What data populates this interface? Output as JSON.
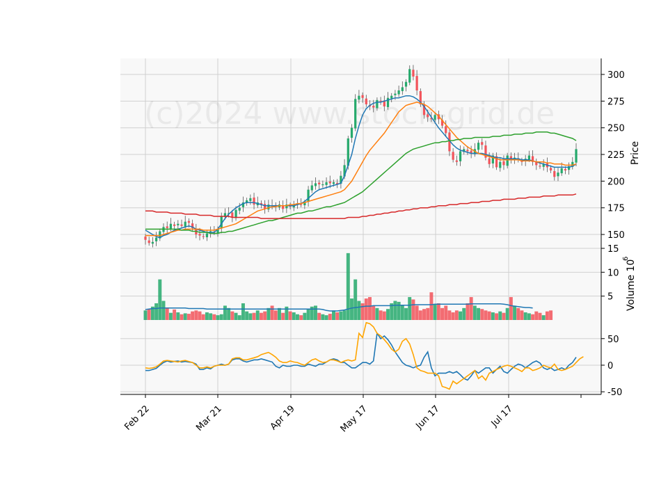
{
  "chart_data": {
    "type": "candlestick",
    "watermark": "(c)2024 www.stock-grid.de",
    "x_ticks": [
      "Feb 22",
      "Mar 21",
      "Apr 19",
      "May 17",
      "Jun 17",
      "Jul 17"
    ],
    "colors": {
      "up": "#26a96c",
      "down": "#f2545b",
      "grid": "#d0d0d0",
      "panel": "#f8f8f8"
    },
    "price_panel": {
      "ylabel": "Price",
      "yticks": [
        150,
        175,
        200,
        225,
        250,
        275,
        300
      ],
      "ylim": [
        137,
        315
      ],
      "close": [
        145,
        142,
        143,
        147,
        153,
        157,
        156,
        160,
        158,
        160,
        158,
        162,
        161,
        156,
        150,
        149,
        148,
        151,
        153,
        152,
        155,
        167,
        170,
        170,
        166,
        173,
        175,
        180,
        182,
        184,
        178,
        180,
        178,
        174,
        178,
        177,
        176,
        178,
        174,
        178,
        176,
        178,
        179,
        178,
        180,
        192,
        196,
        198,
        197,
        197,
        199,
        198,
        199,
        197,
        205,
        215,
        240,
        250,
        277,
        280,
        278,
        272,
        270,
        269,
        276,
        275,
        270,
        278,
        280,
        282,
        285,
        288,
        293,
        305,
        298,
        285,
        272,
        262,
        260,
        258,
        262,
        258,
        252,
        245,
        228,
        220,
        218,
        228,
        230,
        228,
        226,
        230,
        236,
        234,
        222,
        216,
        224,
        213,
        218,
        215,
        224,
        220,
        222,
        220,
        218,
        221,
        224,
        218,
        215,
        214,
        216,
        213,
        210,
        204,
        208,
        212,
        210,
        214,
        218,
        230
      ]
    },
    "moving_averages": {
      "fast": {
        "color": "#1f77b4",
        "values": [
          154,
          152,
          150,
          148,
          147,
          149,
          150,
          152,
          154,
          155,
          156,
          157,
          158,
          157,
          155,
          154,
          153,
          152,
          152,
          152,
          155,
          160,
          165,
          169,
          172,
          175,
          177,
          179,
          180,
          180,
          180,
          179,
          178,
          177,
          177,
          177,
          177,
          177,
          177,
          177,
          177,
          177,
          178,
          179,
          181,
          184,
          187,
          190,
          192,
          193,
          194,
          195,
          196,
          197,
          198,
          205,
          215,
          225,
          240,
          252,
          262,
          268,
          271,
          273,
          274,
          274,
          275,
          276,
          277,
          278,
          278,
          279,
          280,
          280,
          279,
          277,
          274,
          270,
          265,
          260,
          255,
          250,
          246,
          242,
          238,
          234,
          231,
          229,
          228,
          227,
          226,
          226,
          226,
          226,
          225,
          224,
          223,
          222,
          222,
          221,
          221,
          221,
          221,
          221,
          220,
          220,
          220,
          219,
          218,
          217,
          216,
          215,
          214,
          213,
          213,
          213,
          213,
          213,
          214,
          216
        ]
      },
      "medium": {
        "color": "#ff7f0e",
        "values": [
          149,
          149,
          149,
          149,
          149,
          150,
          151,
          152,
          153,
          154,
          154,
          155,
          155,
          155,
          155,
          155,
          154,
          154,
          154,
          154,
          155,
          156,
          157,
          158,
          159,
          160,
          162,
          164,
          166,
          168,
          170,
          172,
          173,
          174,
          175,
          176,
          176,
          177,
          177,
          177,
          178,
          178,
          179,
          179,
          180,
          181,
          182,
          183,
          184,
          185,
          186,
          187,
          188,
          189,
          190,
          192,
          196,
          200,
          206,
          212,
          218,
          224,
          229,
          233,
          237,
          241,
          245,
          250,
          255,
          260,
          265,
          268,
          271,
          272,
          273,
          274,
          273,
          272,
          270,
          267,
          264,
          261,
          257,
          253,
          249,
          245,
          241,
          238,
          235,
          232,
          230,
          228,
          226,
          225,
          224,
          223,
          222,
          221,
          220,
          220,
          220,
          220,
          220,
          220,
          219,
          219,
          219,
          219,
          218,
          218,
          218,
          217,
          217,
          216,
          216,
          216,
          215,
          215,
          215,
          216
        ]
      },
      "slow": {
        "color": "#2ca02c",
        "values": [
          155,
          155,
          155,
          155,
          155,
          155,
          155,
          155,
          155,
          155,
          154,
          154,
          154,
          153,
          153,
          152,
          152,
          152,
          151,
          151,
          151,
          152,
          152,
          153,
          153,
          154,
          155,
          156,
          157,
          158,
          159,
          160,
          161,
          162,
          163,
          163,
          164,
          165,
          166,
          167,
          168,
          169,
          170,
          170,
          171,
          172,
          172,
          173,
          174,
          175,
          176,
          176,
          177,
          178,
          179,
          180,
          182,
          184,
          186,
          188,
          190,
          193,
          196,
          199,
          202,
          205,
          208,
          211,
          214,
          217,
          220,
          223,
          226,
          228,
          230,
          231,
          232,
          233,
          234,
          235,
          236,
          236,
          237,
          237,
          238,
          238,
          239,
          239,
          240,
          240,
          240,
          241,
          241,
          241,
          241,
          241,
          242,
          242,
          242,
          243,
          243,
          243,
          244,
          244,
          244,
          245,
          245,
          245,
          246,
          246,
          246,
          246,
          245,
          245,
          244,
          243,
          242,
          241,
          240,
          238
        ]
      },
      "long": {
        "color": "#d62728",
        "values": [
          172,
          172,
          172,
          171,
          171,
          171,
          171,
          170,
          170,
          170,
          170,
          169,
          169,
          169,
          169,
          168,
          168,
          168,
          168,
          167,
          167,
          167,
          167,
          167,
          166,
          166,
          166,
          166,
          166,
          166,
          166,
          166,
          165,
          165,
          165,
          165,
          165,
          165,
          165,
          165,
          165,
          165,
          165,
          165,
          165,
          165,
          165,
          165,
          165,
          165,
          165,
          165,
          165,
          165,
          165,
          165,
          166,
          166,
          166,
          166,
          167,
          167,
          168,
          168,
          169,
          169,
          170,
          170,
          171,
          171,
          172,
          172,
          173,
          173,
          174,
          174,
          175,
          175,
          175,
          176,
          176,
          177,
          177,
          177,
          178,
          178,
          178,
          179,
          179,
          179,
          180,
          180,
          180,
          181,
          181,
          181,
          182,
          182,
          182,
          183,
          183,
          183,
          183,
          184,
          184,
          184,
          185,
          185,
          185,
          185,
          186,
          186,
          186,
          186,
          187,
          187,
          187,
          187,
          187,
          188
        ]
      }
    },
    "volume_panel": {
      "ylabel": "Volume  10",
      "ylabel_exponent": "6",
      "yticks": [
        5,
        10,
        15
      ],
      "ylim": [
        0,
        15
      ],
      "values": [
        2.0,
        2.3,
        2.8,
        3.5,
        8.5,
        4.0,
        2.5,
        1.5,
        2.2,
        1.6,
        1.2,
        1.4,
        1.3,
        1.8,
        2.0,
        1.8,
        1.2,
        1.6,
        1.4,
        1.2,
        1.0,
        1.2,
        3.0,
        2.5,
        1.8,
        1.5,
        1.0,
        3.5,
        1.8,
        1.4,
        1.5,
        2.0,
        1.5,
        1.8,
        2.5,
        3.0,
        2.0,
        2.5,
        1.5,
        2.8,
        1.8,
        1.6,
        1.2,
        1.0,
        1.5,
        2.3,
        2.8,
        3.0,
        1.5,
        1.2,
        1.0,
        1.3,
        2.0,
        1.6,
        1.8,
        2.0,
        14.0,
        4.5,
        8.5,
        4.0,
        3.5,
        4.5,
        4.8,
        3.0,
        2.5,
        2.0,
        1.8,
        2.3,
        3.5,
        4.0,
        3.8,
        3.0,
        2.5,
        4.8,
        4.3,
        3.0,
        2.0,
        2.3,
        2.5,
        5.8,
        3.2,
        3.5,
        2.5,
        3.0,
        2.0,
        1.6,
        2.0,
        1.8,
        2.5,
        3.5,
        4.8,
        3.0,
        2.5,
        2.3,
        2.0,
        1.8,
        1.6,
        1.4,
        1.8,
        1.5,
        2.5,
        4.8,
        3.0,
        2.5,
        2.0,
        1.6,
        1.4,
        1.2,
        1.8,
        1.5,
        1.0,
        1.8,
        2.0
      ],
      "ma": [
        2.2,
        2.3,
        2.4,
        2.4,
        2.5,
        2.5,
        2.5,
        2.5,
        2.5,
        2.5,
        2.5,
        2.5,
        2.4,
        2.4,
        2.4,
        2.4,
        2.4,
        2.3,
        2.3,
        2.3,
        2.3,
        2.3,
        2.3,
        2.3,
        2.3,
        2.3,
        2.3,
        2.3,
        2.3,
        2.3,
        2.3,
        2.3,
        2.3,
        2.3,
        2.3,
        2.3,
        2.3,
        2.3,
        2.3,
        2.3,
        2.3,
        2.3,
        2.3,
        2.3,
        2.3,
        2.3,
        2.3,
        2.3,
        2.3,
        2.2,
        2.0,
        1.9,
        1.9,
        1.9,
        2.0,
        2.1,
        2.3,
        2.5,
        2.6,
        2.7,
        2.8,
        2.9,
        2.9,
        3.0,
        3.0,
        3.0,
        3.0,
        3.0,
        3.0,
        3.1,
        3.1,
        3.1,
        3.1,
        3.1,
        3.2,
        3.2,
        3.2,
        3.2,
        3.2,
        3.2,
        3.3,
        3.3,
        3.3,
        3.3,
        3.3,
        3.3,
        3.3,
        3.3,
        3.3,
        3.3,
        3.4,
        3.4,
        3.4,
        3.4,
        3.4,
        3.4,
        3.4,
        3.4,
        3.4,
        3.3,
        3.2,
        3.0,
        2.9,
        2.8,
        2.7,
        2.6,
        2.6,
        2.5
      ]
    },
    "oscillator_panel": {
      "yticks": [
        -50,
        0,
        50
      ],
      "ylim": [
        -55,
        85
      ],
      "series": [
        {
          "color": "#1f77b4",
          "values": [
            -10,
            -10,
            -8,
            -6,
            0,
            5,
            8,
            6,
            7,
            8,
            6,
            7,
            6,
            5,
            2,
            -8,
            -8,
            -5,
            -7,
            -2,
            0,
            2,
            0,
            2,
            10,
            12,
            12,
            8,
            6,
            8,
            10,
            10,
            12,
            10,
            8,
            6,
            -2,
            -5,
            0,
            -2,
            -2,
            0,
            0,
            -2,
            -2,
            2,
            0,
            -2,
            2,
            2,
            6,
            10,
            12,
            10,
            5,
            5,
            0,
            -5,
            -5,
            0,
            5,
            5,
            2,
            8,
            60,
            50,
            55,
            48,
            38,
            25,
            15,
            5,
            0,
            -2,
            -5,
            -2,
            0,
            15,
            25,
            -5,
            -20,
            -15,
            -15,
            -15,
            -12,
            -15,
            -12,
            -18,
            -25,
            -28,
            -20,
            -10,
            -15,
            -10,
            -5,
            -5,
            -15,
            -8,
            -2,
            -12,
            -15,
            -8,
            -2,
            2,
            0,
            -5,
            0,
            5,
            8,
            4,
            -5,
            -8,
            -5,
            -10,
            -8,
            -5,
            -8,
            0,
            5,
            15
          ]
        },
        {
          "color": "#ffa500",
          "values": [
            -5,
            -6,
            -5,
            -3,
            2,
            8,
            9,
            8,
            7,
            6,
            8,
            9,
            7,
            5,
            0,
            -5,
            -5,
            -3,
            -5,
            -2,
            0,
            0,
            0,
            2,
            12,
            14,
            14,
            10,
            10,
            12,
            14,
            16,
            20,
            22,
            24,
            20,
            15,
            8,
            5,
            5,
            8,
            6,
            5,
            2,
            0,
            5,
            10,
            12,
            8,
            5,
            6,
            10,
            10,
            8,
            5,
            8,
            10,
            8,
            10,
            60,
            52,
            80,
            78,
            72,
            60,
            55,
            48,
            40,
            30,
            25,
            30,
            45,
            50,
            40,
            20,
            -5,
            -10,
            -12,
            -15,
            -15,
            -15,
            -20,
            -40,
            -42,
            -45,
            -30,
            -35,
            -30,
            -25,
            -20,
            -15,
            -10,
            -25,
            -20,
            -28,
            -15,
            -12,
            -8,
            -5,
            -2,
            0,
            -2,
            -5,
            -8,
            -12,
            -5,
            -5,
            -10,
            -8,
            -5,
            0,
            -3,
            -5,
            2,
            -8,
            -10,
            -8,
            -5,
            -2,
            5,
            12,
            16
          ]
        }
      ]
    }
  }
}
